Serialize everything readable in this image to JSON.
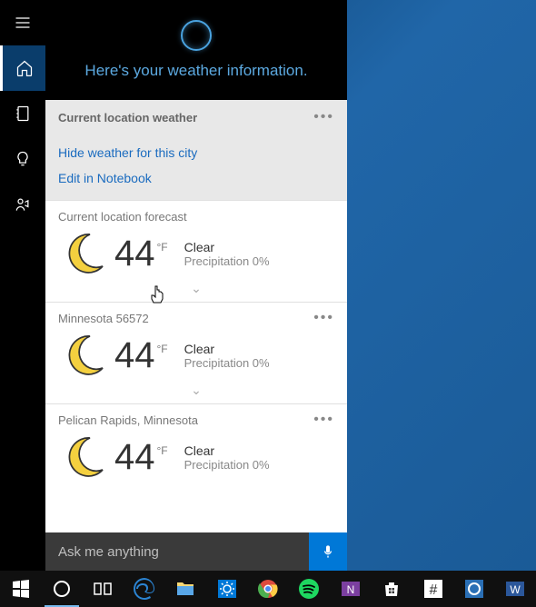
{
  "cortana": {
    "headline": "Here's your weather information."
  },
  "section": {
    "title": "Current location weather",
    "hide_link": "Hide weather for this city",
    "edit_link": "Edit in Notebook"
  },
  "forecasts": [
    {
      "location": "Current location forecast",
      "temp": "44",
      "unit": "°F",
      "condition": "Clear",
      "precip": "Precipitation 0%"
    },
    {
      "location": "Minnesota 56572",
      "temp": "44",
      "unit": "°F",
      "condition": "Clear",
      "precip": "Precipitation 0%"
    },
    {
      "location": "Pelican Rapids, Minnesota",
      "temp": "44",
      "unit": "°F",
      "condition": "Clear",
      "precip": "Precipitation 0%"
    }
  ],
  "search": {
    "placeholder": "Ask me anything"
  },
  "more": "•••",
  "chevron": "⌄"
}
